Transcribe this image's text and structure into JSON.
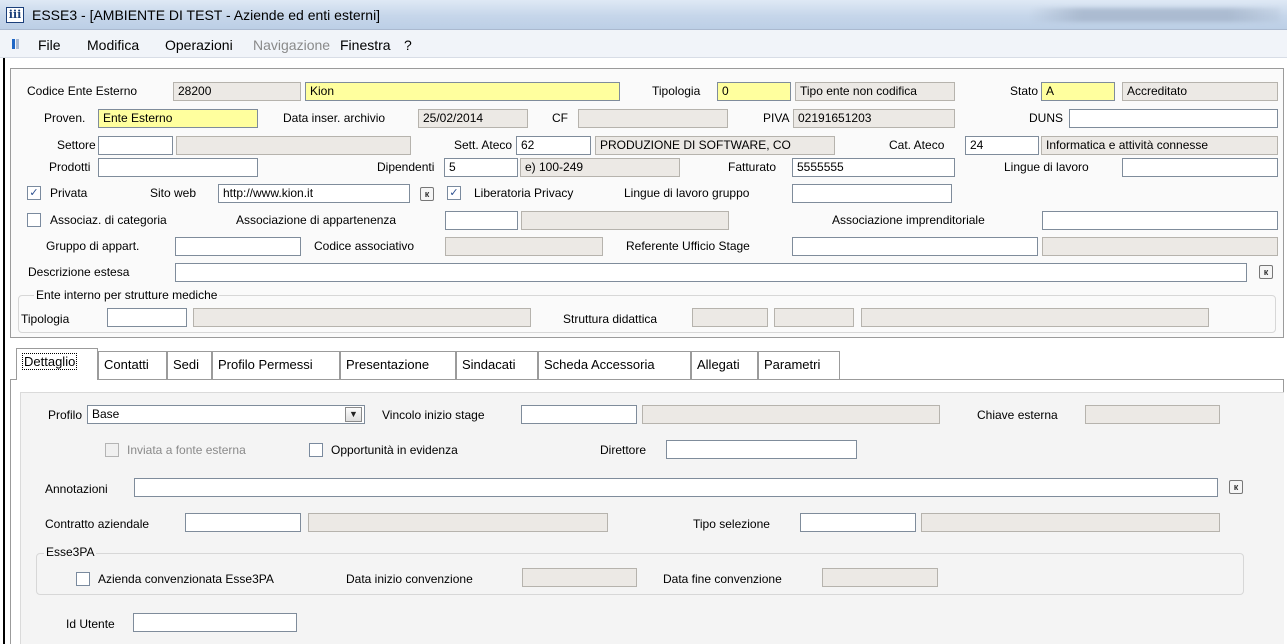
{
  "window": {
    "title": "ESSE3 - [AMBIENTE DI TEST - Aziende ed enti esterni]",
    "app_icon_text": "ⅲ"
  },
  "menu": {
    "items": [
      {
        "label": "File",
        "disabled": false
      },
      {
        "label": "Modifica",
        "disabled": false
      },
      {
        "label": "Operazioni",
        "disabled": false
      },
      {
        "label": "Navigazione",
        "disabled": true
      },
      {
        "label": "Finestra",
        "disabled": false
      },
      {
        "label": "?",
        "disabled": false
      }
    ]
  },
  "header": {
    "codice_label": "Codice Ente Esterno",
    "codice": "28200",
    "nome": "Kion",
    "tipologia_label": "Tipologia",
    "tipologia": "0",
    "tipologia_desc": "Tipo ente non codifica",
    "stato_label": "Stato",
    "stato": "A",
    "stato_desc": "Accreditato",
    "proven_label": "Proven.",
    "proven": "Ente Esterno",
    "data_label": "Data inser. archivio",
    "data": "25/02/2014",
    "cf_label": "CF",
    "cf": "",
    "piva_label": "PIVA",
    "piva": "02191651203",
    "duns_label": "DUNS",
    "duns": "",
    "settore_label": "Settore",
    "settore": "",
    "settore_desc": "",
    "sett_ateco_label": "Sett. Ateco",
    "sett_ateco": "62",
    "sett_ateco_desc": "PRODUZIONE DI SOFTWARE, CO",
    "cat_ateco_label": "Cat. Ateco",
    "cat_ateco": "24",
    "cat_ateco_desc": "Informatica e attività connesse",
    "prodotti_label": "Prodotti",
    "prodotti": "",
    "dipendenti_label": "Dipendenti",
    "dipendenti": "5",
    "dipendenti_desc": "e) 100-249",
    "fatturato_label": "Fatturato",
    "fatturato": "5555555",
    "lingue_label": "Lingue di lavoro",
    "lingue": "",
    "privata_label": "Privata",
    "privata_checked": "✓",
    "sito_label": "Sito web",
    "sito": "http://www.kion.it",
    "liberatoria_label": "Liberatoria Privacy",
    "liberatoria_checked": "✓",
    "lingue_gruppo_label": "Lingue di lavoro gruppo",
    "lingue_gruppo": "",
    "associaz_label": "Associaz. di categoria",
    "associaz_checked": "",
    "assoc_app_label": "Associazione di appartenenza",
    "assoc_app": "",
    "assoc_app_desc": "",
    "assoc_impr_label": "Associazione imprenditoriale",
    "assoc_impr": "",
    "gruppo_label": "Gruppo di appart.",
    "gruppo": "",
    "cod_assoc_label": "Codice associativo",
    "cod_assoc": "",
    "referente_label": "Referente Ufficio Stage",
    "referente": "",
    "referente_desc": "",
    "descrizione_label": "Descrizione estesa",
    "descrizione": "",
    "ente_interno_title": "Ente interno per strutture mediche",
    "ente_tipologia_label": "Tipologia",
    "ente_tipologia": "",
    "ente_tipologia_desc": "",
    "struttura_label": "Struttura didattica",
    "struttura_1": "",
    "struttura_2": "",
    "struttura_3": "",
    "lookup_glyph": "к"
  },
  "tabs": [
    {
      "label": "Dettaglio"
    },
    {
      "label": "Contatti"
    },
    {
      "label": "Sedi"
    },
    {
      "label": "Profilo Permessi"
    },
    {
      "label": "Presentazione"
    },
    {
      "label": "Sindacati"
    },
    {
      "label": "Scheda Accessoria"
    },
    {
      "label": "Allegati"
    },
    {
      "label": "Parametri"
    }
  ],
  "dettaglio": {
    "profilo_label": "Profilo",
    "profilo": "Base",
    "dropdown_glyph": "▼",
    "vincolo_label": "Vincolo inizio stage",
    "vincolo": "",
    "vincolo_desc": "",
    "chiave_label": "Chiave esterna",
    "chiave": "",
    "inviata_label": "Inviata a fonte esterna",
    "inviata_checked": "",
    "opportunita_label": "Opportunità in evidenza",
    "opportunita_checked": "",
    "direttore_label": "Direttore",
    "direttore": "",
    "annotazioni_label": "Annotazioni",
    "annotazioni": "",
    "contratto_label": "Contratto aziendale",
    "contratto": "",
    "contratto_desc": "",
    "tipo_sel_label": "Tipo selezione",
    "tipo_sel": "",
    "tipo_sel_desc": "",
    "esse3pa_title": "Esse3PA",
    "convenzionata_label": "Azienda convenzionata Esse3PA",
    "convenzionata_checked": "",
    "data_inizio_label": "Data inizio convenzione",
    "data_inizio": "",
    "data_fine_label": "Data fine convenzione",
    "data_fine": "",
    "id_utente_label": "Id Utente",
    "id_utente": ""
  }
}
